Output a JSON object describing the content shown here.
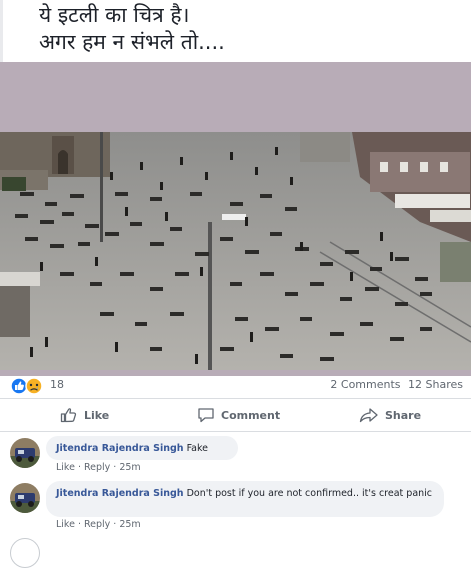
{
  "post": {
    "lines": [
      "ये इटली का चित्र है।",
      "अगर हम न संभले तो...."
    ]
  },
  "reactions": {
    "icons": [
      "like-icon",
      "sad-icon"
    ],
    "count": "18",
    "comments": "2 Comments",
    "shares": "12 Shares"
  },
  "actions": {
    "like": "Like",
    "comment": "Comment",
    "share": "Share"
  },
  "comments": [
    {
      "author": "Jitendra Rajendra Singh",
      "text": "Fake",
      "like": "Like",
      "reply": "Reply",
      "time": "25m"
    },
    {
      "author": "Jitendra Rajendra Singh",
      "text": "Don't post if you are not confirmed.. it's creat panic",
      "like": "Like",
      "reply": "Reply",
      "time": "25m"
    }
  ],
  "colors": {
    "link": "#385898",
    "muted": "#606770",
    "band": "#b8acb7",
    "like_blue": "#1877f2",
    "sad_yellow": "#f7b125"
  }
}
